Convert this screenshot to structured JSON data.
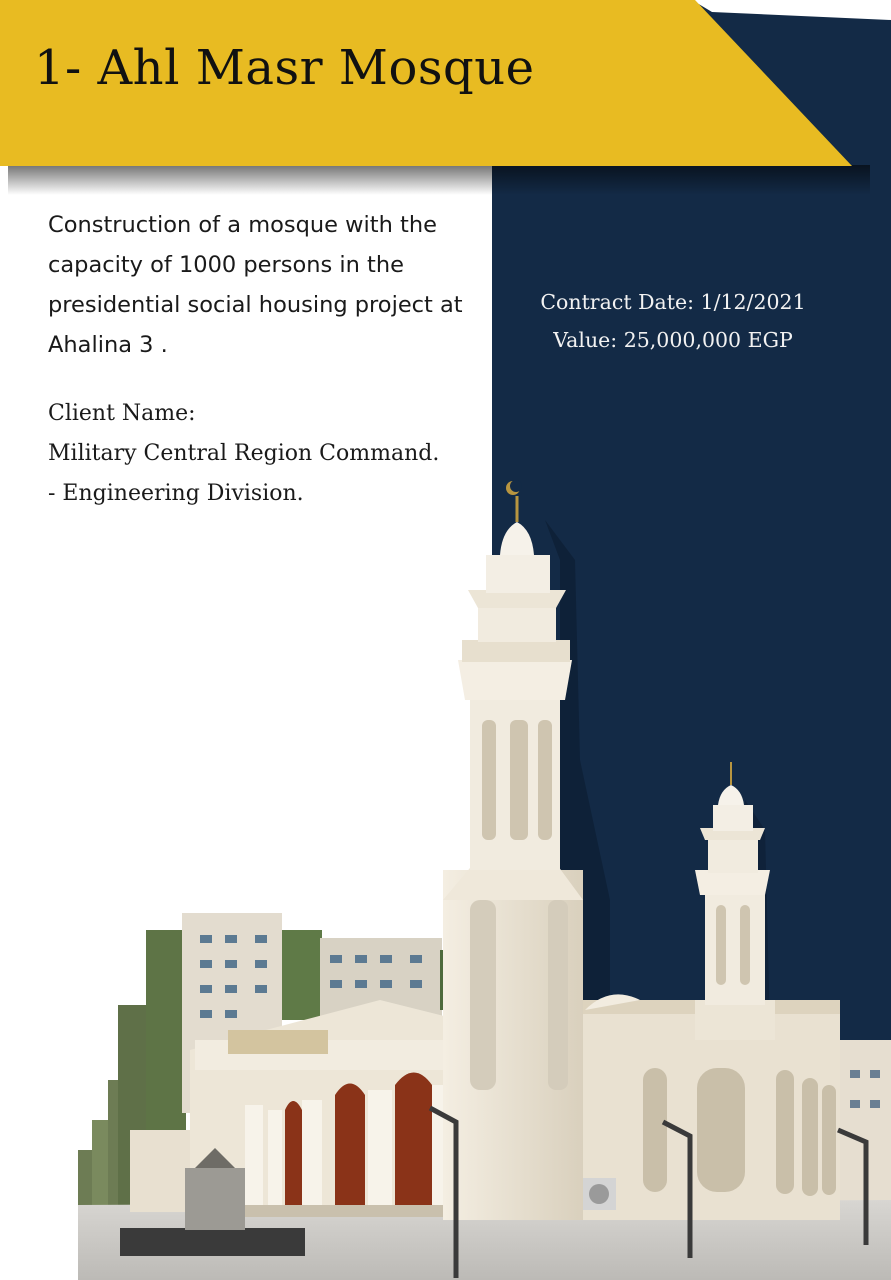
{
  "header": {
    "title": "1- Ahl Masr Mosque"
  },
  "description": "Construction of a mosque with the capacity of 1000 persons in the presidential social housing project at Ahalina 3 .",
  "client": {
    "label": "Client Name:",
    "line1": "Military Central Region Command.",
    "line2": "- Engineering Division."
  },
  "contract": {
    "date": "Contract Date: 1/12/2021",
    "value": "Value: 25,000,000 EGP"
  },
  "colors": {
    "banner": "#e8bb22",
    "navy": "#132a46",
    "mosque": "#ece4d4",
    "doors": "#8a3318"
  },
  "icons": {
    "minaret_finial": "crescent-icon"
  }
}
